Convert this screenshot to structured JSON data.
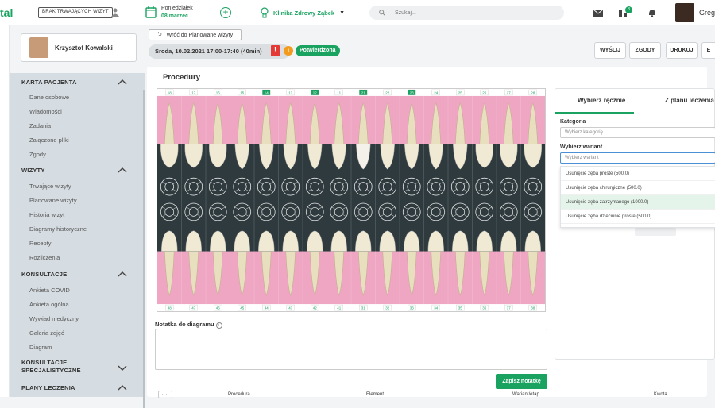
{
  "topbar": {
    "logo": "tal",
    "no_visits": "BRAK TRWAJĄCYCH WIZYT",
    "day": "Poniedziałek",
    "date": "08 marzec",
    "clinic": "Klinika Zdrowy Ząbek",
    "search_placeholder": "Szukaj...",
    "notif_count": "3",
    "user": "Greg"
  },
  "sidebar": {
    "patient": "Krzysztof Kowalski",
    "sections": [
      {
        "title": "KARTA PACJENTA",
        "items": [
          "Dane osobowe",
          "Wiadomości",
          "Zadania",
          "Załączone pliki",
          "Zgody"
        ]
      },
      {
        "title": "WIZYTY",
        "items": [
          "Trwające wizyty",
          "Planowane wizyty",
          "Historia wizyt",
          "Diagramy historyczne",
          "Recepty",
          "Rozliczenia"
        ]
      },
      {
        "title": "KONSULTACJE",
        "items": [
          "Ankieta COVID",
          "Ankieta ogólna",
          "Wywiad medyczny",
          "Galeria zdjęć",
          "Diagram"
        ]
      },
      {
        "title": "KONSULTACJE SPECJALISTYCZNE",
        "items": []
      },
      {
        "title": "PLANY LECZENIA",
        "items": []
      }
    ]
  },
  "visit": {
    "back": "Wróć do Planowane wizyty",
    "when": "Środa, 10.02.2021 17:00-17:40 (40min)",
    "status": "Potwierdzona",
    "actions": [
      "WYŚLIJ",
      "ZGODY",
      "DRUKUJ",
      "E"
    ]
  },
  "procedures": {
    "title": "Procedury",
    "upper_teeth": [
      "18",
      "17",
      "16",
      "15",
      "14",
      "13",
      "12",
      "11",
      "21",
      "22",
      "23",
      "24",
      "25",
      "26",
      "27",
      "28"
    ],
    "lower_teeth": [
      "48",
      "47",
      "46",
      "45",
      "44",
      "43",
      "42",
      "41",
      "31",
      "32",
      "33",
      "34",
      "35",
      "36",
      "37",
      "38"
    ],
    "selected_teeth": [
      "14",
      "12",
      "21",
      "23"
    ],
    "note_label": "Notatka do diagramu",
    "save": "Zapisz notatkę",
    "table_headers": [
      "Procedura",
      "Element",
      "Wariant/etap",
      "Kwota"
    ]
  },
  "right": {
    "tabs": [
      "Wybierz ręcznie",
      "Z planu leczenia"
    ],
    "category_label": "Kategoria",
    "category_placeholder": "Wybierz kategorię",
    "variant_label": "Wybierz wariant",
    "variant_placeholder": "Wybierz wariant",
    "options": [
      "Usunięcie zęba proste (500.0)",
      "Usunięcie zęba chirurgiczne (500.0)",
      "Usunięcie zęba zatrzymanego (1000.0)",
      "Usunięcie zęba dziecinnie proste (500.0)"
    ],
    "highlighted": 2
  },
  "colors": {
    "accent": "#1aa260",
    "gum": "#efa6c2",
    "chart_bg": "#2e3a3e",
    "menu_bg": "#d6dde2"
  }
}
